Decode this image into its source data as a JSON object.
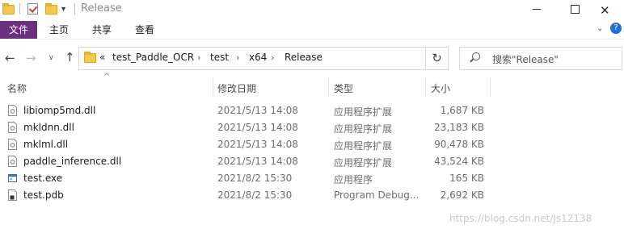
{
  "window": {
    "title": "Release",
    "controls": {
      "minimize": "minimize",
      "maximize": "maximize",
      "close": "✕"
    }
  },
  "ribbon": {
    "tabs": [
      "文件",
      "主页",
      "共享",
      "查看"
    ]
  },
  "nav": {
    "breadcrumb": [
      "test_Paddle_OCR",
      "test",
      "x64",
      "Release"
    ],
    "overflow": "«",
    "search_placeholder": "搜索\"Release\""
  },
  "columns": {
    "name": "名称",
    "date": "修改日期",
    "type": "类型",
    "size": "大小"
  },
  "files": [
    {
      "name": "libiomp5md.dll",
      "date": "2021/5/13 14:08",
      "type": "应用程序扩展",
      "size": "1,687 KB",
      "icon": "dll-icon"
    },
    {
      "name": "mkldnn.dll",
      "date": "2021/5/13 14:08",
      "type": "应用程序扩展",
      "size": "23,183 KB",
      "icon": "dll-icon"
    },
    {
      "name": "mklml.dll",
      "date": "2021/5/13 14:08",
      "type": "应用程序扩展",
      "size": "90,478 KB",
      "icon": "dll-icon"
    },
    {
      "name": "paddle_inference.dll",
      "date": "2021/5/13 14:08",
      "type": "应用程序扩展",
      "size": "43,524 KB",
      "icon": "dll-icon"
    },
    {
      "name": "test.exe",
      "date": "2021/8/2 15:30",
      "type": "应用程序",
      "size": "165 KB",
      "icon": "exe-icon"
    },
    {
      "name": "test.pdb",
      "date": "2021/8/2 15:30",
      "type": "Program Debug...",
      "size": "2,692 KB",
      "icon": "pdb-icon"
    }
  ],
  "watermark": "https://blog.csdn.net/Js12138",
  "colors": {
    "file_tab": "#6a2f7d",
    "folder": "#f2c94c"
  }
}
